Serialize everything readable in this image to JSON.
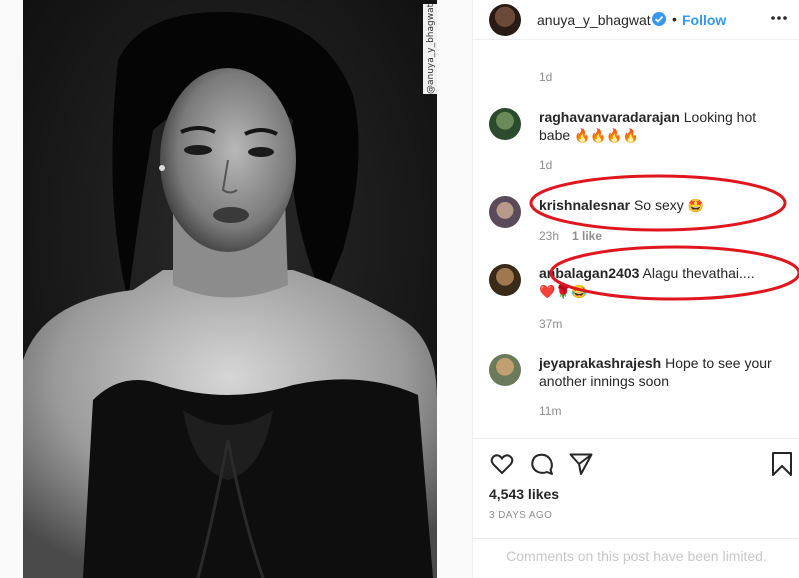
{
  "post": {
    "watermark": "@anuya_y_bhagwat"
  },
  "header": {
    "username": "anuya_y_bhagwat",
    "dot": "•",
    "follow_label": "Follow"
  },
  "caption": {
    "time": "1d"
  },
  "comments": [
    {
      "user": "raghavanvaradarajan",
      "text": "Looking hot babe",
      "emoji": "🔥🔥🔥🔥",
      "time": "1d",
      "likes": ""
    },
    {
      "user": "krishnalesnar",
      "text": "So sexy",
      "emoji": "🤩",
      "time": "23h",
      "likes": "1 like"
    },
    {
      "user": "anbalagan2403",
      "text": "Alagu thevathai.... ",
      "emoji": "❤️🌹😂",
      "time": "37m",
      "likes": ""
    },
    {
      "user": "jeyaprakashrajesh",
      "text": "Hope to see your another innings soon",
      "emoji": "",
      "time": "11m",
      "likes": ""
    }
  ],
  "actions": {
    "likes_count": "4,543 likes",
    "date": "3 DAYS AGO",
    "limited_notice": "Comments on this post have been limited."
  },
  "colors": {
    "accent": "#3897f0",
    "annotation": "#e0161e"
  },
  "icons": [
    "more-options-icon",
    "verified-badge-icon",
    "heart-icon",
    "comment-icon",
    "share-icon",
    "bookmark-icon"
  ]
}
